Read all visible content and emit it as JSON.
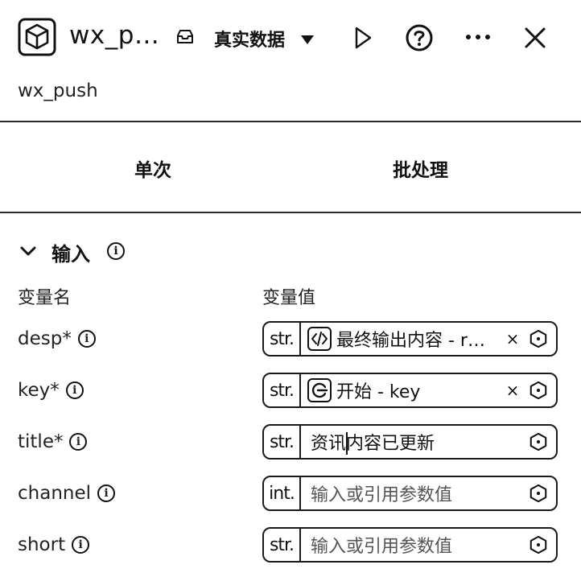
{
  "header": {
    "title": "wx_p…",
    "env_label": "真实数据",
    "icons": [
      "cube-icon",
      "tray-icon",
      "chevron-down-icon",
      "play-icon",
      "help-icon",
      "more-icon",
      "close-icon"
    ]
  },
  "subtitle": "wx_push",
  "tabs": [
    {
      "label": "单次",
      "active": true
    },
    {
      "label": "批处理",
      "active": false
    }
  ],
  "input_section": {
    "title": "输入",
    "col_name": "变量名",
    "col_value": "变量值",
    "params": [
      {
        "name": "desp*",
        "type": "str.",
        "kind": "ref",
        "ref_icon": "code-icon",
        "value": "最终输出内容 - r…",
        "clear": "×"
      },
      {
        "name": "key*",
        "type": "str.",
        "kind": "ref",
        "ref_icon": "start-icon",
        "value": "开始 - key",
        "clear": "×"
      },
      {
        "name": "title*",
        "type": "str.",
        "kind": "text",
        "value": "资讯内容已更新"
      },
      {
        "name": "channel",
        "type": "int.",
        "kind": "placeholder",
        "value": "输入或引用参数值"
      },
      {
        "name": "short",
        "type": "str.",
        "kind": "placeholder",
        "value": "输入或引用参数值"
      }
    ]
  },
  "colors": {
    "text": "#111111",
    "border": "#1a1a1a",
    "background": "#ffffff"
  }
}
